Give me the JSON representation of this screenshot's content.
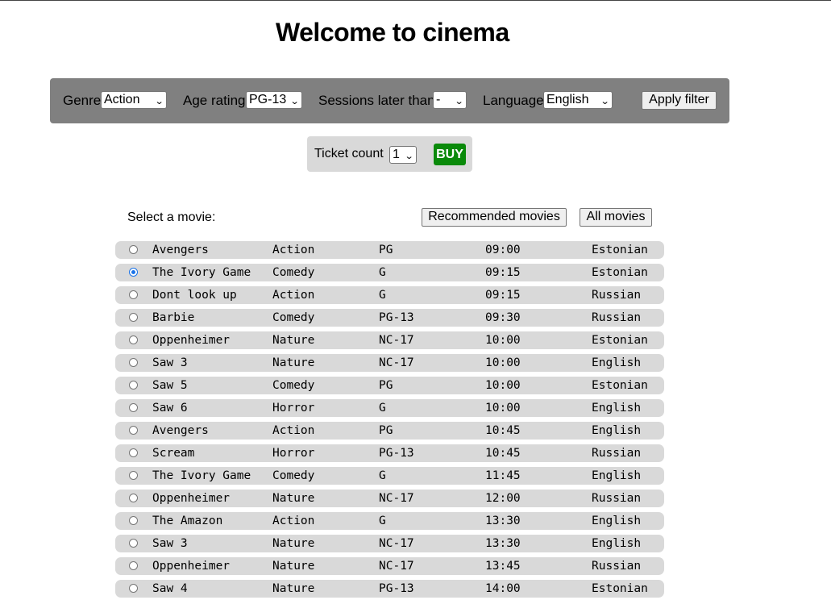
{
  "page": {
    "title": "Welcome to cinema"
  },
  "filters": {
    "genre_label": "Genre",
    "genre_value": "Action",
    "age_label": "Age rating",
    "age_value": "PG-13",
    "sessions_label": "Sessions later than",
    "sessions_value": "-",
    "language_label": "Language",
    "language_value": "English",
    "apply_label": "Apply filter"
  },
  "tickets": {
    "count_label": "Ticket count",
    "count_value": "1",
    "buy_label": "BUY",
    "buy_color": "#0a8a0a"
  },
  "movies_section": {
    "select_label": "Select a movie:",
    "recommended_label": "Recommended movies",
    "all_label": "All movies"
  },
  "icons": {
    "dropdown": "chevron-down-icon"
  },
  "movies": [
    {
      "title": "Avengers",
      "genre": "Action",
      "age": "PG",
      "time": "09:00",
      "language": "Estonian",
      "selected": false
    },
    {
      "title": "The Ivory Game",
      "genre": "Comedy",
      "age": "G",
      "time": "09:15",
      "language": "Estonian",
      "selected": true
    },
    {
      "title": "Dont look up",
      "genre": "Action",
      "age": "G",
      "time": "09:15",
      "language": "Russian",
      "selected": false
    },
    {
      "title": "Barbie",
      "genre": "Comedy",
      "age": "PG-13",
      "time": "09:30",
      "language": "Russian",
      "selected": false
    },
    {
      "title": "Oppenheimer",
      "genre": "Nature",
      "age": "NC-17",
      "time": "10:00",
      "language": "Estonian",
      "selected": false
    },
    {
      "title": "Saw 3",
      "genre": "Nature",
      "age": "NC-17",
      "time": "10:00",
      "language": "English",
      "selected": false
    },
    {
      "title": "Saw 5",
      "genre": "Comedy",
      "age": "PG",
      "time": "10:00",
      "language": "Estonian",
      "selected": false
    },
    {
      "title": "Saw 6",
      "genre": "Horror",
      "age": "G",
      "time": "10:00",
      "language": "English",
      "selected": false
    },
    {
      "title": "Avengers",
      "genre": "Action",
      "age": "PG",
      "time": "10:45",
      "language": "English",
      "selected": false
    },
    {
      "title": "Scream",
      "genre": "Horror",
      "age": "PG-13",
      "time": "10:45",
      "language": "Russian",
      "selected": false
    },
    {
      "title": "The Ivory Game",
      "genre": "Comedy",
      "age": "G",
      "time": "11:45",
      "language": "English",
      "selected": false
    },
    {
      "title": "Oppenheimer",
      "genre": "Nature",
      "age": "NC-17",
      "time": "12:00",
      "language": "Russian",
      "selected": false
    },
    {
      "title": "The Amazon",
      "genre": "Action",
      "age": "G",
      "time": "13:30",
      "language": "English",
      "selected": false
    },
    {
      "title": "Saw 3",
      "genre": "Nature",
      "age": "NC-17",
      "time": "13:30",
      "language": "English",
      "selected": false
    },
    {
      "title": "Oppenheimer",
      "genre": "Nature",
      "age": "NC-17",
      "time": "13:45",
      "language": "Russian",
      "selected": false
    },
    {
      "title": "Saw 4",
      "genre": "Nature",
      "age": "PG-13",
      "time": "14:00",
      "language": "Estonian",
      "selected": false
    }
  ]
}
